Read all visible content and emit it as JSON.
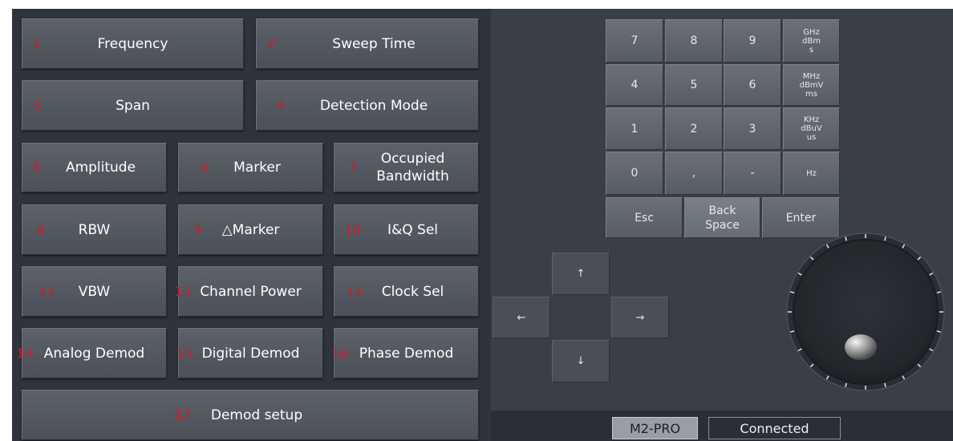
{
  "function_buttons": [
    {
      "num": "1",
      "label": "Frequency"
    },
    {
      "num": "2",
      "label": "Sweep Time"
    },
    {
      "num": "3",
      "label": "Span"
    },
    {
      "num": "4",
      "label": "Detection Mode"
    },
    {
      "num": "5",
      "label": "Amplitude"
    },
    {
      "num": "6",
      "label": "Marker"
    },
    {
      "num": "7",
      "label_line1": "Occupied",
      "label_line2": "Bandwidth"
    },
    {
      "num": "8",
      "label": "RBW"
    },
    {
      "num": "9",
      "label": "△Marker"
    },
    {
      "num": "10",
      "label": "I&Q Sel"
    },
    {
      "num": "11",
      "label": "VBW"
    },
    {
      "num": "12",
      "label": "Channel Power"
    },
    {
      "num": "13",
      "label": "Clock Sel"
    },
    {
      "num": "14",
      "label": "Analog Demod"
    },
    {
      "num": "15",
      "label": "Digital Demod"
    },
    {
      "num": "16",
      "label": "Phase Demod"
    },
    {
      "num": "17",
      "label": "Demod setup"
    }
  ],
  "keypad": {
    "digits": [
      "7",
      "8",
      "9",
      "4",
      "5",
      "6",
      "1",
      "2",
      "3",
      "0",
      ",",
      "-"
    ],
    "units": [
      {
        "l1": "GHz",
        "l2": "dBm",
        "l3": "s"
      },
      {
        "l1": "MHz",
        "l2": "dBmV",
        "l3": "ms"
      },
      {
        "l1": "KHz",
        "l2": "dBuV",
        "l3": "us"
      },
      {
        "l1": "Hz"
      }
    ],
    "esc": "Esc",
    "back_l1": "Back",
    "back_l2": "Space",
    "enter": "Enter"
  },
  "arrows": {
    "up": "↑",
    "left": "←",
    "right": "→",
    "down": "↓"
  },
  "status": {
    "device": "M2-PRO",
    "connection": "Connected"
  }
}
